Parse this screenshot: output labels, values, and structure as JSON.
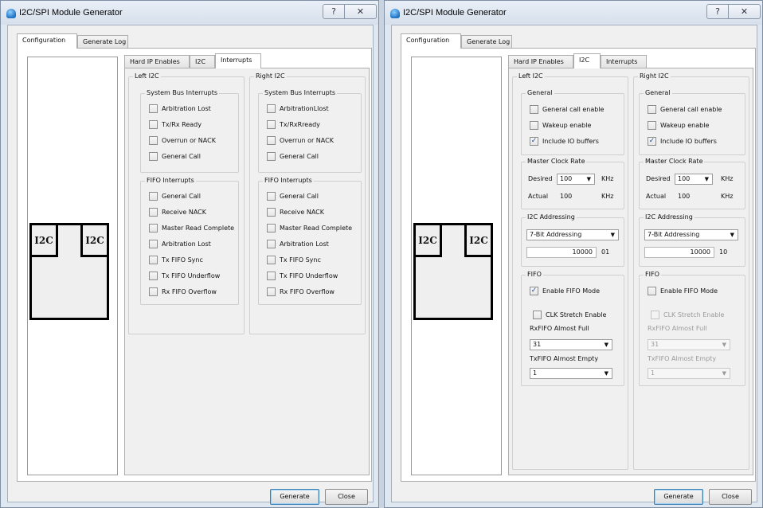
{
  "left_window": {
    "title": "I2C/SPI Module Generator",
    "help_glyph": "?",
    "close_glyph": "✕",
    "tabs": [
      "Configuration",
      "Generate Log"
    ],
    "chip_labels": [
      "I2C",
      "I2C"
    ],
    "subtabs": [
      "Hard IP Enables",
      "I2C",
      "Interrupts"
    ],
    "active_subtab": "Interrupts",
    "left_title": "Left I2C",
    "right_title": "Right I2C",
    "left_system_bus_title": "System Bus Interrupts",
    "left_system_bus": [
      "Arbitration Lost",
      "Tx/Rx Ready",
      "Overrun or NACK",
      "General Call"
    ],
    "left_fifo_title": "FIFO Interrupts",
    "left_fifo": [
      "General Call",
      "Receive NACK",
      "Master Read Complete",
      "Arbitration Lost",
      "Tx FIFO Sync",
      "Tx FIFO Underflow",
      "Rx FIFO Overflow"
    ],
    "right_system_bus_title": "System Bus Interrupts",
    "right_system_bus": [
      "ArbitrationLlost",
      "Tx/RxRready",
      "Overrun or NACK",
      "General Call"
    ],
    "right_fifo_title": "FIFO Interrupts",
    "right_fifo": [
      "General Call",
      "Receive NACK",
      "Master Read Complete",
      "Arbitration Lost",
      "Tx FIFO Sync",
      "Tx FIFO Underflow",
      "Rx FIFO Overflow"
    ],
    "generate_label": "Generate",
    "close_label": "Close"
  },
  "right_window": {
    "title": "I2C/SPI Module Generator",
    "help_glyph": "?",
    "close_glyph": "✕",
    "tabs": [
      "Configuration",
      "Generate Log"
    ],
    "chip_labels": [
      "I2C",
      "I2C"
    ],
    "subtabs": [
      "Hard IP Enables",
      "I2C",
      "Interrupts"
    ],
    "active_subtab": "I2C",
    "left": {
      "title": "Left I2C",
      "general_title": "General",
      "general_call": "General call enable",
      "wakeup": "Wakeup  enable",
      "include_io": "Include IO buffers",
      "include_io_checked": true,
      "clock_title": "Master Clock Rate",
      "desired_label": "Desired",
      "desired_value": "100",
      "desired_unit": "KHz",
      "actual_label": "Actual",
      "actual_value": "100",
      "actual_unit": "KHz",
      "addressing_title": "I2C Addressing",
      "addressing_mode": "7-Bit Addressing",
      "address_value": "10000",
      "address_suffix": "01",
      "fifo_title": "FIFO",
      "enable_fifo": "Enable FIFO Mode",
      "enable_fifo_checked": true,
      "clk_stretch": "CLK Stretch Enable",
      "rx_almost_full_label": "RxFIFO Almost Full",
      "rx_almost_full_value": "31",
      "tx_almost_empty_label": "TxFIFO Almost Empty",
      "tx_almost_empty_value": "1"
    },
    "right": {
      "title": "Right  I2C",
      "general_title": "General",
      "general_call": "General call enable",
      "wakeup": "Wakeup  enable",
      "include_io": "Include IO buffers",
      "include_io_checked": true,
      "clock_title": "Master Clock Rate",
      "desired_label": "Desired",
      "desired_value": "100",
      "desired_unit": "KHz",
      "actual_label": "Actual",
      "actual_value": "100",
      "actual_unit": "KHz",
      "addressing_title": "I2C Addressing",
      "addressing_mode": "7-Bit Addressing",
      "address_value": "10000",
      "address_suffix": "10",
      "fifo_title": "FIFO",
      "enable_fifo": "Enable FIFO Mode",
      "enable_fifo_checked": false,
      "clk_stretch": "CLK Stretch Enable",
      "rx_almost_full_label": "RxFIFO Almost Full",
      "rx_almost_full_value": "31",
      "tx_almost_empty_label": "TxFIFO Almost Empty",
      "tx_almost_empty_value": "1"
    },
    "generate_label": "Generate",
    "close_label": "Close"
  },
  "glyphs": {
    "check": "✓",
    "dropdown": "▼"
  }
}
